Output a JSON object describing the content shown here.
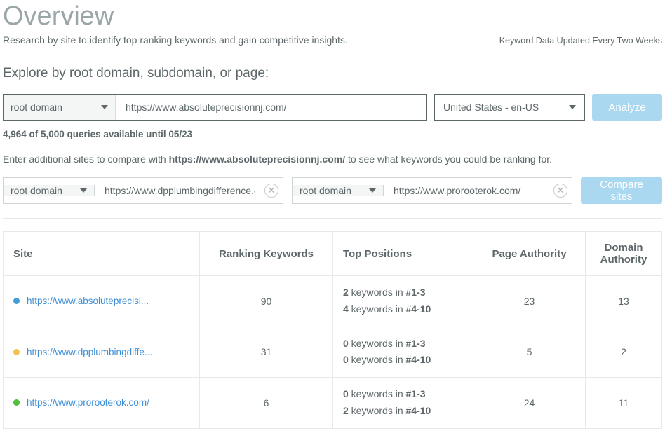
{
  "header": {
    "title": "Overview",
    "subtitle": "Research by site to identify top ranking keywords and gain competitive insights.",
    "updateNote": "Keyword Data Updated Every Two Weeks"
  },
  "explore": {
    "label": "Explore by root domain, subdomain, or page:",
    "scope": "root domain",
    "url": "https://www.absoluteprecisionnj.com/",
    "locale": "United States - en-US",
    "analyze": "Analyze",
    "queryNote": "4,964 of 5,000 queries available until 05/23"
  },
  "compare": {
    "promptPrefix": "Enter additional sites to compare with ",
    "promptBold": "https://www.absoluteprecisionnj.com/",
    "promptSuffix": " to see what keywords you could be ranking for.",
    "button": "Compare sites",
    "sites": [
      {
        "scope": "root domain",
        "url": "https://www.dpplumbingdifference.com/"
      },
      {
        "scope": "root domain",
        "url": "https://www.prorooterok.com/"
      }
    ]
  },
  "table": {
    "headers": {
      "site": "Site",
      "ranking": "Ranking Keywords",
      "top": "Top Positions",
      "pa": "Page Authority",
      "da": "Domain Authority"
    },
    "rows": [
      {
        "color": "#3f9ed8",
        "site": "https://www.absoluteprecisi...",
        "ranking": "90",
        "top1": "2",
        "top1label": " keywords in ",
        "top1range": "#1-3",
        "top2": "4",
        "top2label": " keywords in ",
        "top2range": "#4-10",
        "pa": "23",
        "da": "13"
      },
      {
        "color": "#f3c24e",
        "site": "https://www.dpplumbingdiffe...",
        "ranking": "31",
        "top1": "0",
        "top1label": " keywords in ",
        "top1range": "#1-3",
        "top2": "0",
        "top2label": " keywords in ",
        "top2range": "#4-10",
        "pa": "5",
        "da": "2"
      },
      {
        "color": "#4fbf3a",
        "site": "https://www.prorooterok.com/",
        "ranking": "6",
        "top1": "0",
        "top1label": " keywords in ",
        "top1range": "#1-3",
        "top2": "2",
        "top2label": " keywords in ",
        "top2range": "#4-10",
        "pa": "24",
        "da": "11"
      }
    ]
  }
}
